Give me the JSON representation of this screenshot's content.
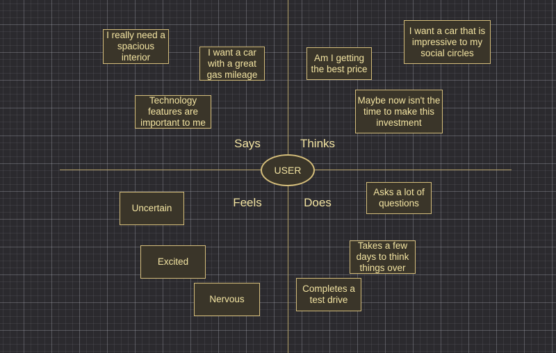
{
  "colors": {
    "background": "#2b2a2e",
    "note_fill": "#3a3529",
    "note_border": "#d6bf7c",
    "text": "#f3e4a2"
  },
  "center": "USER",
  "quadrants": {
    "says": "Says",
    "thinks": "Thinks",
    "feels": "Feels",
    "does": "Does"
  },
  "notes": {
    "says": [
      "I really need a spacious interior",
      "I want a car with a great gas mileage",
      "Technology features are important to me"
    ],
    "thinks": [
      "Am I getting the best price",
      "I want a car that is impressive to my social circles",
      "Maybe now isn't the time to make this investment"
    ],
    "feels": [
      "Uncertain",
      "Excited",
      "Nervous"
    ],
    "does": [
      "Asks a lot of questions",
      "Takes a few days to think things over",
      "Completes a test drive"
    ]
  }
}
